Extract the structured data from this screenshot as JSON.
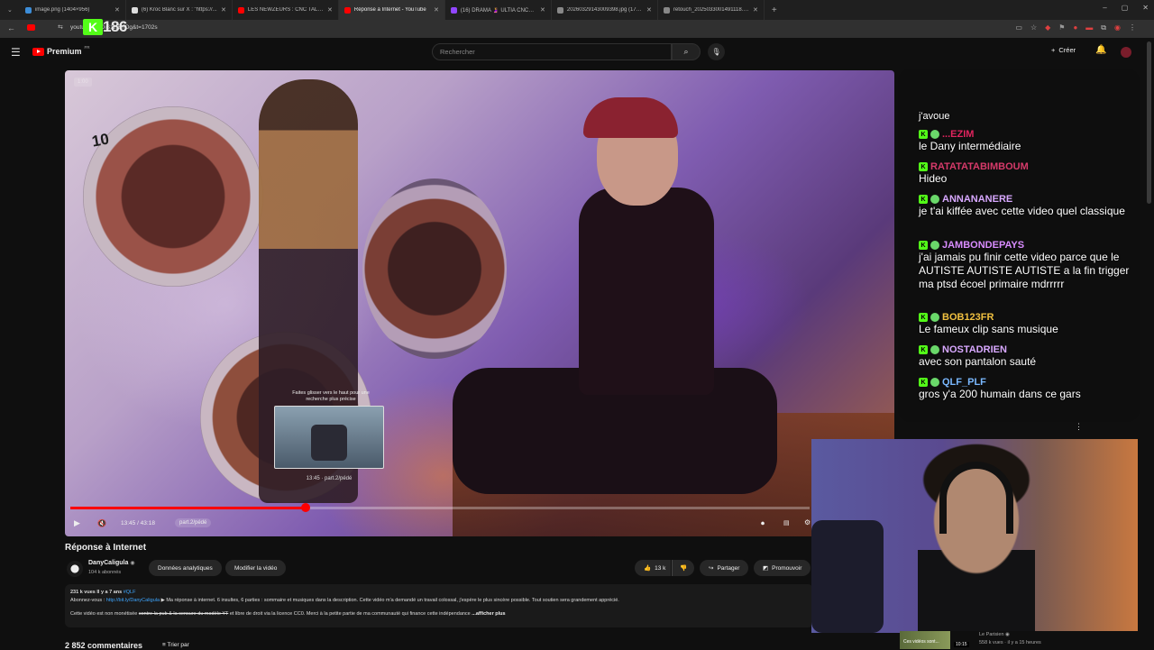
{
  "browser": {
    "tabs": [
      {
        "label": "image.png (1404×956)",
        "color": "#3c8dd8",
        "active": false
      },
      {
        "label": "(6) Kroc Blanc sur X : \"https://...",
        "color": "#dddddd",
        "active": false
      },
      {
        "label": "LES NEWZEURS : CNC TALENT...",
        "color": "#ff0000",
        "active": false
      },
      {
        "label": "Réponse à Internet - YouTube",
        "color": "#ff0000",
        "active": true
      },
      {
        "label": "(16) DRAMA 🤰 ULTIA CNC?!...",
        "color": "#9146ff",
        "active": false
      },
      {
        "label": "20260329143009398.jpg (1736...",
        "color": "#888888",
        "active": false
      },
      {
        "label": "retouch_2025033001491118.jp...",
        "color": "#888888",
        "active": false
      }
    ],
    "url": "youtu... ...GDiS1zj5YOg&t=1702s",
    "kick_count": "186"
  },
  "header": {
    "logo_text": "Premium",
    "logo_region": "FR",
    "search_placeholder": "Rechercher",
    "create_label": "Créer"
  },
  "player": {
    "corner_label": "1:00",
    "washer_number": "10",
    "preview_hint": "Faites glisser vers le haut pour une recherche plus précise",
    "preview_time": "13:45 · part.2/pédé",
    "time_display": "13:45 / 43:18",
    "chapter": "part.2/pédé",
    "progress_fraction": 0.318
  },
  "video": {
    "title": "Réponse à Internet",
    "channel": "DanyCaligula",
    "verified": "◉",
    "subscribers": "104 k abonnés",
    "analytics_label": "Données analytiques",
    "edit_label": "Modifier la vidéo",
    "likes": "13 k",
    "share_label": "Partager",
    "promote_label": "Promouvoir"
  },
  "description": {
    "views_date": "231 k vues  Il y a 7 ans",
    "tag": "#QLF",
    "subscribe_prefix": "Abonnez-vous : ",
    "subscribe_link": "http://bit.ly/DanyCaligula",
    "line1_text": " ▶ Ma réponse à internet. 6 insultes, 6 parties : sommaire et musiques dans la description. Cette vidéo m'a demandé un travail colossal, j'espère le plus sincère possible. Tout soutien sera grandement apprécié.",
    "line2_start": "Cette vidéo est non monétisée ",
    "line2_strike": "contre la pub & la censure du modèle YT",
    "line2_rest": " et libre de droit via la licence CC0. Merci à la petite partie de ma communauté qui finance cette indépendance",
    "more_label": "...afficher plus"
  },
  "comments": {
    "count": "2 852 commentaires",
    "sort_label": "Trier par"
  },
  "chat": {
    "first_line": "j'avoue",
    "messages": [
      {
        "user": "...EZIM",
        "color": "#e0245e",
        "text": "le Dany intermédiaire"
      },
      {
        "user": "RATATATABIMBOUM",
        "color": "#d63a6a",
        "text": "Hideo"
      },
      {
        "user": "ANNANANERE",
        "color": "#d8a8ff",
        "text": "je t'ai kiffée avec cette video quel classique"
      },
      {
        "user": "JAMBONDEPAYS",
        "color": "#d98cff",
        "text": "j'ai jamais pu finir cette video parce que le AUTISTE AUTISTE AUTISTE a la fin trigger ma ptsd écoel primaire mdrrrrr"
      },
      {
        "user": "BOB123FR",
        "color": "#f0c040",
        "text": "Le fameux clip sans musique"
      },
      {
        "user": "NOSTADRIEN",
        "color": "#d8a8ff",
        "text": "avec son pantalon sauté"
      },
      {
        "user": "QLF_PLF",
        "color": "#7ab8ff",
        "text": "gros y'a 200 humain dans ce gars"
      }
    ]
  },
  "recommendation": {
    "thumb_text": "Ces vidéos sont...",
    "channel": "Le Parisien ◉",
    "meta": "558 k vues · il y a 15 heures",
    "duration": "10:15"
  }
}
